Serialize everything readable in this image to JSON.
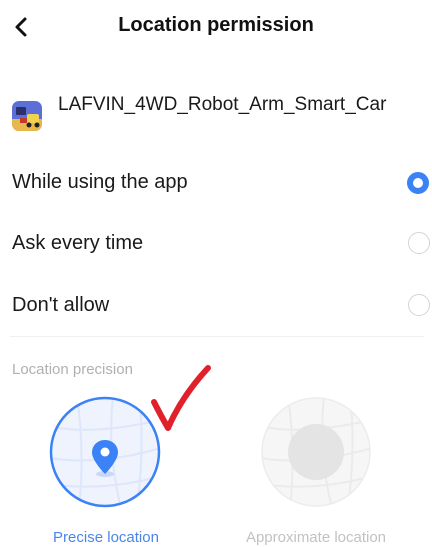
{
  "header": {
    "title": "Location permission"
  },
  "app": {
    "name": "LAFVIN_4WD_Robot_Arm_Smart_Car",
    "icon": "robot-car-app-icon"
  },
  "options": [
    {
      "label": "While using the app",
      "selected": true
    },
    {
      "label": "Ask every time",
      "selected": false
    },
    {
      "label": "Don't allow",
      "selected": false
    }
  ],
  "precision": {
    "section_label": "Location precision",
    "precise_label": "Precise location",
    "approximate_label": "Approximate location",
    "selected": "precise"
  },
  "colors": {
    "accent": "#3b82f6",
    "checkmark": "#e0202a",
    "muted": "#b0b0b0"
  }
}
